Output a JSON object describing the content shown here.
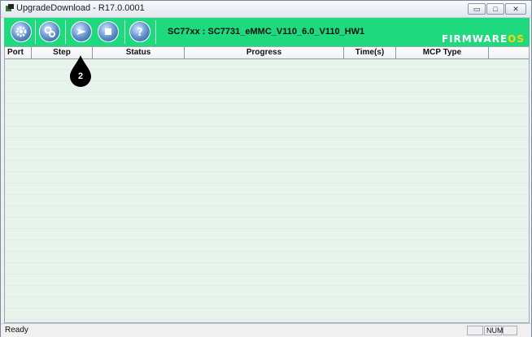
{
  "window": {
    "title": "UpgradeDownload - R17.0.0001",
    "controls": {
      "minimize": "▭",
      "maximize": "□",
      "close": "✕"
    }
  },
  "toolbar": {
    "device_label": "SC77xx : SC7731_eMMC_V110_6.0_V110_HW1",
    "brand_main": "FIRMWARE",
    "brand_suffix": "OS",
    "buttons": [
      "settings-icon",
      "load-packet-icon",
      "start-download-icon",
      "stop-icon",
      "help-icon"
    ],
    "background_color": "#1ed97e"
  },
  "grid": {
    "columns": [
      "Port",
      "Step",
      "Status",
      "Progress",
      "Time(s)",
      "MCP Type"
    ]
  },
  "callout": {
    "number": "2"
  },
  "statusbar": {
    "text": "Ready",
    "num_indicator": "NUM"
  }
}
